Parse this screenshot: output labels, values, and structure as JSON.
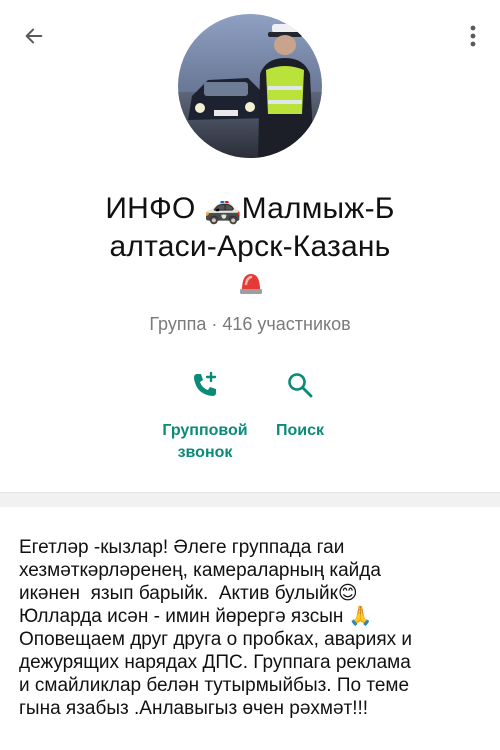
{
  "header": {
    "back_icon": "arrow-left-icon",
    "menu_icon": "more-vertical-icon"
  },
  "group": {
    "title_line1": "ИНФО 🚓Малмыж-Б",
    "title_line2": "алтаси-Арск-Казань",
    "title_emoji": "🚨",
    "meta": "Группа · 416 участников"
  },
  "actions": {
    "call_label": "Групповой\nзвонок",
    "search_label": "Поиск",
    "accent_color": "#0a8a78"
  },
  "description": {
    "text": "Егетләр -кызлар! Әлеге группада гаи\nхезмәткәрләренең, камераларның кайда\nикәнен  язып барыйк.  Актив булыйк😊\nЮлларда исән - имин йөрергә язсын 🙏\nОповещаем друг друга о пробках, авариях и\nдежурящих нарядах ДПС. Группага реклама\nи смайликлар белән тутырмыйбыз. По теме\nгына язабыз .Анлавыгыз өчен рәхмәт!!!"
  }
}
